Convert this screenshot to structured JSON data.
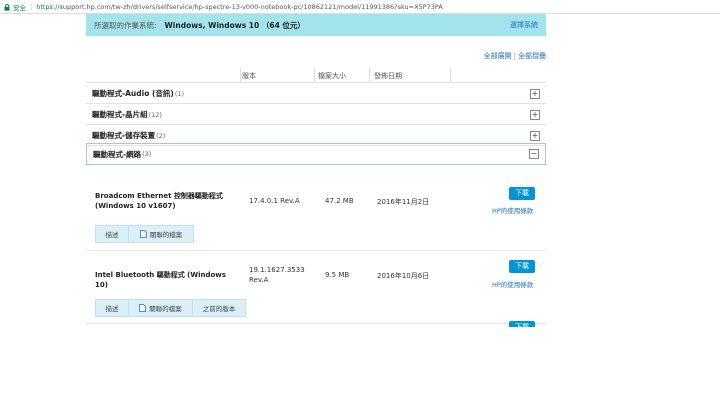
{
  "browser": {
    "secure_label": "安全",
    "separator": "|",
    "scheme": "https://",
    "url_rest": "support.hp.com/tw-zh/drivers/selfservice/hp-spectre-13-v000-notebook-pc/10862121/model/11991386?sku=X5P73PA"
  },
  "os_bar": {
    "label": "所選取的作業系統:",
    "value": "Windows, Windows 10 （64 位元）",
    "change_link": "選擇系統"
  },
  "expand": {
    "expand_all": "全部展開",
    "divider": "|",
    "collapse_all": "全部摺疊"
  },
  "columns": {
    "version": "版本",
    "size": "檔案大小",
    "date": "發佈日期"
  },
  "categories": [
    {
      "label": "驅動程式-Audio (音訊)",
      "count": "(1)",
      "toggle": "+"
    },
    {
      "label": "驅動程式-晶片組",
      "count": "(12)",
      "toggle": "+"
    },
    {
      "label": "驅動程式-儲存裝置",
      "count": "(2)",
      "toggle": "+"
    },
    {
      "label": "驅動程式-網路",
      "count": "(3)",
      "toggle": "−"
    }
  ],
  "drivers": [
    {
      "name": "Broadcom Ethernet 控制器驅動程式 (Windows 10 v1607)",
      "version": "17.4.0.1 Rev.A",
      "size": "47.2 MB",
      "date": "2016年11月2日",
      "download": "下載",
      "terms": "HP的使用條款",
      "tabs": [
        "描述",
        "關聯的檔案"
      ]
    },
    {
      "name": "Intel Bluetooth 驅動程式 (Windows 10)",
      "version": "19.1.1627.3533 Rev.A",
      "size": "9.5 MB",
      "date": "2016年10月6日",
      "download": "下載",
      "terms": "HP的使用條款",
      "tabs": [
        "描述",
        "關聯的檔案",
        "之前的版本"
      ]
    }
  ],
  "third_download": "下載",
  "colors": {
    "os_bar": "#a3e4ec",
    "link": "#1a6fc9",
    "download": "#0096d6",
    "tab": "#dbeff8"
  }
}
